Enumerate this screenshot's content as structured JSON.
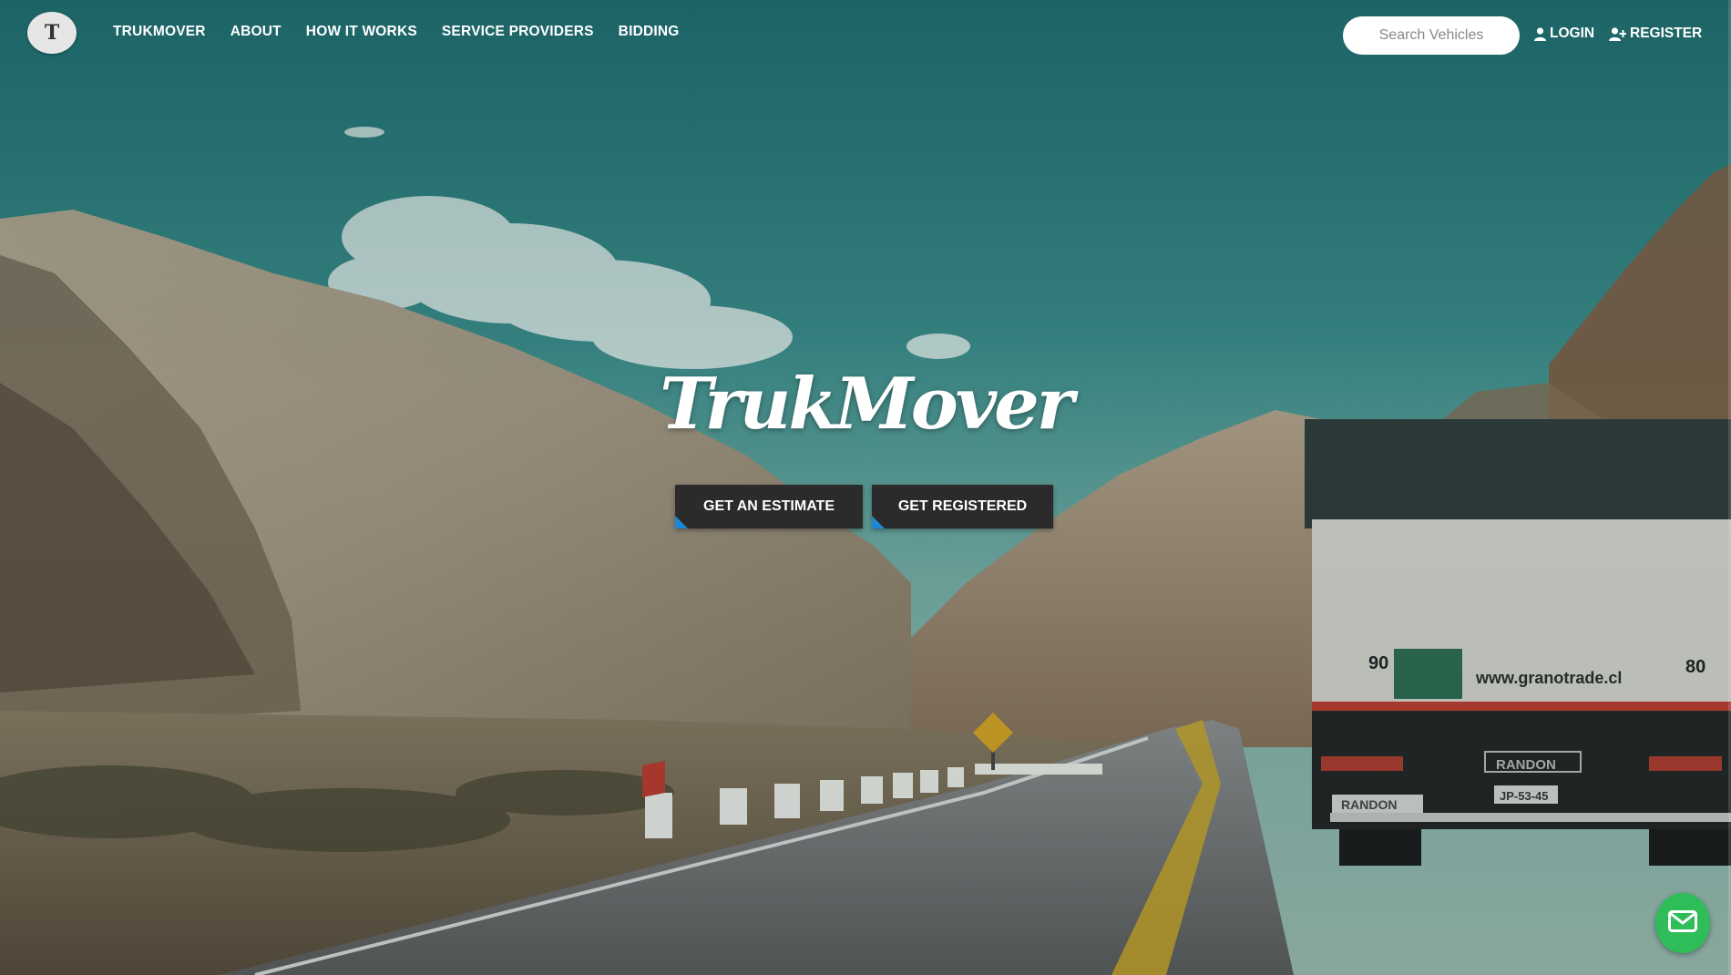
{
  "nav": {
    "logo_letter": "T",
    "links": [
      "TRUKMOVER",
      "ABOUT",
      "HOW IT WORKS",
      "SERVICE PROVIDERS",
      "BIDDING"
    ]
  },
  "search": {
    "placeholder": "Search Vehicles"
  },
  "auth": {
    "login": "LOGIN",
    "register": "REGISTER"
  },
  "hero": {
    "brand": "TrukMover",
    "buttons": {
      "estimate": "GET AN ESTIMATE",
      "registered": "GET REGISTERED"
    }
  },
  "truck": {
    "left_number": "90",
    "right_number": "80",
    "website": "www.granotrade.cl",
    "make": "RANDON",
    "plate": "JP-53-45"
  },
  "colors": {
    "accent_blue": "#1e88d6",
    "button_dark": "#2b2b2b",
    "mail_green": "#2ebd59",
    "sky_teal": "#2a6b6e"
  },
  "icons": {
    "login": "user-icon",
    "register": "user-plus-icon",
    "mail": "envelope-icon",
    "road_sign": "animal-crossing-sign"
  }
}
